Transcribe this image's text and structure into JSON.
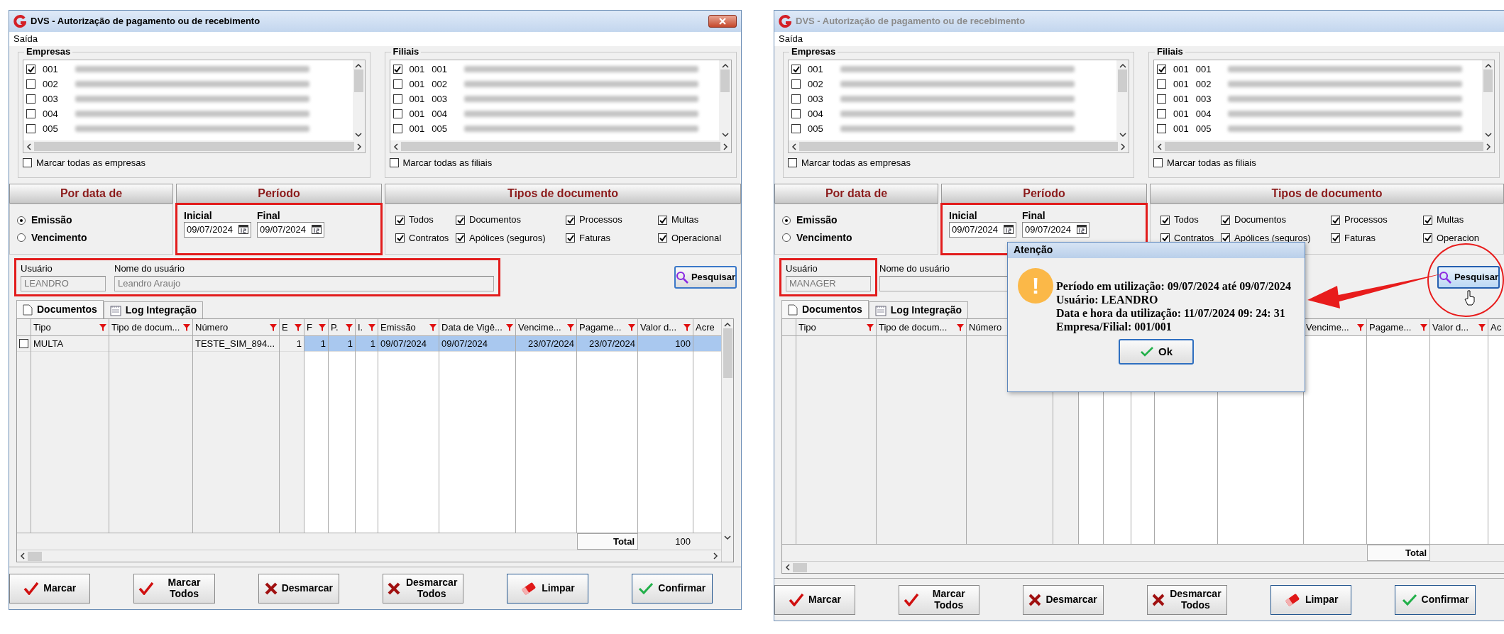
{
  "windows": [
    {
      "title": "DVS - Autorização de pagamento ou de recebimento",
      "active": true,
      "close_button": true,
      "menu": [
        "Saída"
      ],
      "empresas": {
        "title": "Empresas",
        "items": [
          {
            "code": "001",
            "checked": true
          },
          {
            "code": "002",
            "checked": false
          },
          {
            "code": "003",
            "checked": false
          },
          {
            "code": "004",
            "checked": false
          },
          {
            "code": "005",
            "checked": false
          }
        ],
        "select_all": {
          "label": "Marcar todas as empresas",
          "checked": false
        }
      },
      "filiais": {
        "title": "Filiais",
        "items": [
          {
            "code": "001",
            "branch": "001",
            "checked": true
          },
          {
            "code": "001",
            "branch": "002",
            "checked": false
          },
          {
            "code": "001",
            "branch": "003",
            "checked": false
          },
          {
            "code": "001",
            "branch": "004",
            "checked": false
          },
          {
            "code": "001",
            "branch": "005",
            "checked": false
          }
        ],
        "select_all": {
          "label": "Marcar todas as filiais",
          "checked": false
        }
      },
      "por_data": {
        "title": "Por data de",
        "options": [
          {
            "label": "Emissão",
            "selected": true
          },
          {
            "label": "Vencimento",
            "selected": false
          }
        ]
      },
      "periodo": {
        "title": "Período",
        "highlighted": true,
        "inicial_label": "Inicial",
        "inicial": "09/07/2024",
        "final_label": "Final",
        "final": "09/07/2024"
      },
      "tipos": {
        "title": "Tipos de documento",
        "items": [
          {
            "label": "Todos",
            "checked": true
          },
          {
            "label": "Documentos",
            "checked": true
          },
          {
            "label": "Processos",
            "checked": true
          },
          {
            "label": "Multas",
            "checked": true
          },
          {
            "label": "Contratos",
            "checked": true
          },
          {
            "label": "Apólices (seguros)",
            "checked": true
          },
          {
            "label": "Faturas",
            "checked": true
          },
          {
            "label": "Operacional",
            "checked": true
          }
        ]
      },
      "usuario": {
        "label": "Usuário",
        "value": "LEANDRO"
      },
      "nome": {
        "label": "Nome do usuário",
        "value": "Leandro Araujo"
      },
      "fields_highlighted": true,
      "search_button": {
        "label": "Pesquisar",
        "focused": false
      },
      "tabs": [
        {
          "label": "Documentos",
          "selected": true
        },
        {
          "label": "Log Integração",
          "selected": false
        }
      ],
      "grid": {
        "columns": [
          {
            "label": "Tipo",
            "filter": true
          },
          {
            "label": "Tipo de docum...",
            "filter": true
          },
          {
            "label": "Número",
            "filter": true
          },
          {
            "label": "E",
            "filter": true
          },
          {
            "label": "F",
            "filter": true
          },
          {
            "label": "P.",
            "filter": true
          },
          {
            "label": "I.",
            "filter": true
          },
          {
            "label": "Emissão",
            "filter": true
          },
          {
            "label": "Data de Vigê...",
            "filter": true
          },
          {
            "label": "Vencime...",
            "filter": true
          },
          {
            "label": "Pagame...",
            "filter": true
          },
          {
            "label": "Valor d...",
            "filter": true
          },
          {
            "label": "Acre"
          }
        ],
        "rows": [
          {
            "checked": false,
            "selected": true,
            "cells": [
              "MULTA",
              null,
              "TESTE_SIM_894...",
              "1",
              "1",
              "1",
              "1",
              "09/07/2024",
              "09/07/2024",
              "23/07/2024",
              "23/07/2024",
              "100",
              null
            ]
          }
        ],
        "total_label": "Total",
        "total_value": "100"
      },
      "buttons": [
        {
          "label": "Marcar",
          "kind": "mark"
        },
        {
          "label": "Marcar Todos",
          "kind": "mark"
        },
        {
          "label": "Desmarcar",
          "kind": "unmark"
        },
        {
          "label": "Desmarcar Todos",
          "kind": "unmark"
        },
        {
          "label": "Limpar",
          "kind": "clear"
        },
        {
          "label": "Confirmar",
          "kind": "confirm"
        }
      ]
    },
    {
      "title": "DVS - Autorização de pagamento ou de recebimento",
      "active": false,
      "close_button": false,
      "menu": [
        "Saída"
      ],
      "empresas": {
        "title": "Empresas",
        "items": [
          {
            "code": "001",
            "checked": true
          },
          {
            "code": "002",
            "checked": false
          },
          {
            "code": "003",
            "checked": false
          },
          {
            "code": "004",
            "checked": false
          },
          {
            "code": "005",
            "checked": false
          }
        ],
        "select_all": {
          "label": "Marcar todas as empresas",
          "checked": false
        }
      },
      "filiais": {
        "title": "Filiais",
        "items": [
          {
            "code": "001",
            "branch": "001",
            "checked": true
          },
          {
            "code": "001",
            "branch": "002",
            "checked": false
          },
          {
            "code": "001",
            "branch": "003",
            "checked": false
          },
          {
            "code": "001",
            "branch": "004",
            "checked": false
          },
          {
            "code": "001",
            "branch": "005",
            "checked": false
          }
        ],
        "select_all": {
          "label": "Marcar todas as filiais",
          "checked": false
        }
      },
      "por_data": {
        "title": "Por data de",
        "options": [
          {
            "label": "Emissão",
            "selected": true
          },
          {
            "label": "Vencimento",
            "selected": false
          }
        ]
      },
      "periodo": {
        "title": "Período",
        "highlighted": true,
        "inicial_label": "Inicial",
        "inicial": "09/07/2024",
        "final_label": "Final",
        "final": "09/07/2024"
      },
      "tipos": {
        "title": "Tipos de documento",
        "items": [
          {
            "label": "Todos",
            "checked": true
          },
          {
            "label": "Documentos",
            "checked": true
          },
          {
            "label": "Processos",
            "checked": true
          },
          {
            "label": "Multas",
            "checked": true
          },
          {
            "label": "Contratos",
            "checked": true
          },
          {
            "label": "Apólices (seguros)",
            "checked": true
          },
          {
            "label": "Faturas",
            "checked": true
          },
          {
            "label": "Operacion",
            "checked": true
          }
        ]
      },
      "usuario": {
        "label": "Usuário",
        "value": "MANAGER",
        "highlighted": true
      },
      "nome": {
        "label": "Nome do usuário"
      },
      "search_button": {
        "label": "Pesquisar",
        "focused": true
      },
      "tabs": [
        {
          "label": "Documentos",
          "selected": true
        },
        {
          "label": "Log Integração",
          "selected": false
        }
      ],
      "grid": {
        "columns": [
          {
            "label": "Tipo",
            "filter": true
          },
          {
            "label": "Tipo de docum...",
            "filter": true
          },
          {
            "label": "Número"
          },
          {},
          {},
          {},
          {},
          {},
          {},
          {
            "label": "Vencime...",
            "filter": true
          },
          {
            "label": "Pagame...",
            "filter": true
          },
          {
            "label": "Valor d...",
            "filter": true
          },
          {
            "label": "Ac"
          }
        ],
        "total_label": "Total"
      },
      "buttons": [
        {
          "label": "Marcar",
          "kind": "mark"
        },
        {
          "label": "Marcar Todos",
          "kind": "mark"
        },
        {
          "label": "Desmarcar",
          "kind": "unmark"
        },
        {
          "label": "Desmarcar Todos",
          "kind": "unmark"
        },
        {
          "label": "Limpar",
          "kind": "clear"
        },
        {
          "label": "Confirmar",
          "kind": "confirm"
        }
      ],
      "dialog": {
        "title": "Atenção",
        "icon_glyph": "!",
        "lines": [
          "Período em utilização: 09/07/2024 até 09/07/2024",
          "Usuário: LEANDRO",
          "Data e hora da utilização: 11/07/2024 09: 24: 31",
          "Empresa/Filial: 001/001"
        ],
        "button": "Ok"
      },
      "callout_arrow": true,
      "circle_mark": true,
      "cursor": true
    }
  ]
}
